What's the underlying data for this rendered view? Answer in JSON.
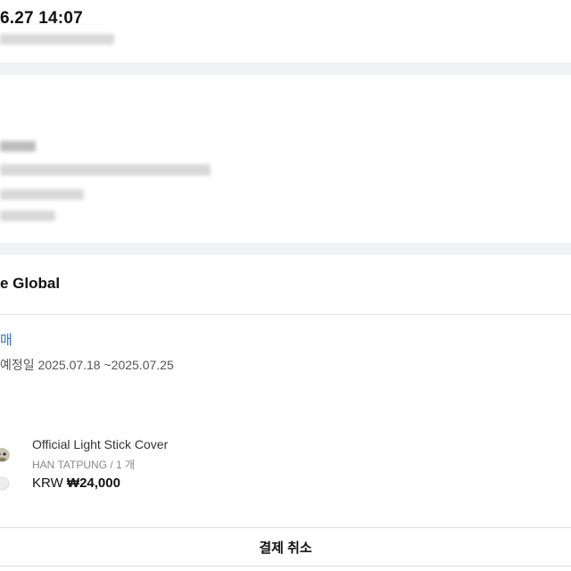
{
  "order": {
    "datetime": "6.27 14:07"
  },
  "shop": {
    "name": "e Global"
  },
  "shipment": {
    "status": "매",
    "estimated_date": "예정일 2025.07.18 ~2025.07.25"
  },
  "product": {
    "name": "Official Light Stick Cover",
    "option": "HAN TATPUNG / 1 개",
    "currency": "KRW",
    "price": "₩24,000",
    "thumbnail_icon": "light-stick-cover-icon"
  },
  "actions": {
    "cancel_label": "결제 취소"
  },
  "colors": {
    "accent_link": "#2f6fd6",
    "band_gray": "#f1f2f4"
  }
}
